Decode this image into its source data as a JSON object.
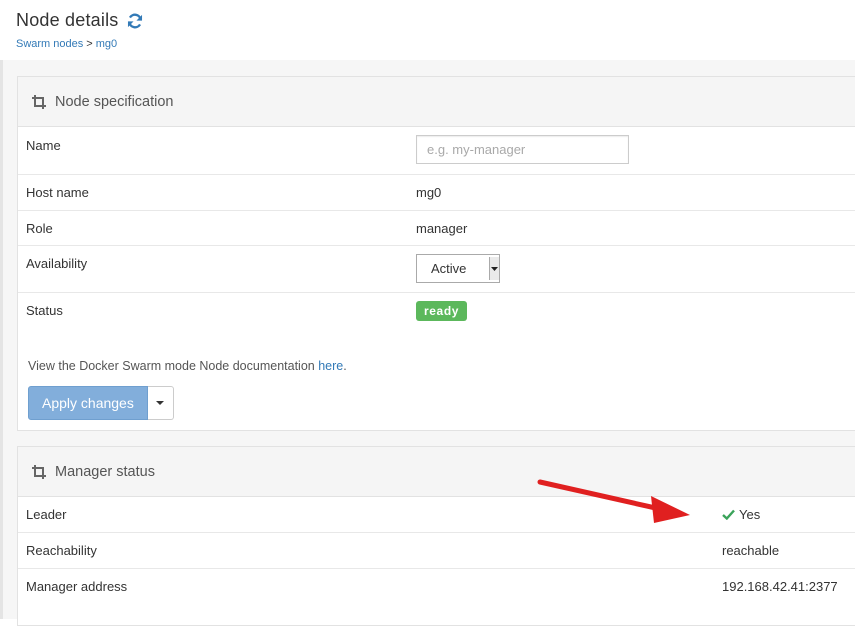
{
  "header": {
    "title": "Node details",
    "breadcrumb": {
      "parent": "Swarm nodes",
      "separator": ">",
      "current": "mg0"
    }
  },
  "node_spec": {
    "title": "Node specification",
    "name_label": "Name",
    "name_placeholder": "e.g. my-manager",
    "host_label": "Host name",
    "host_value": "mg0",
    "role_label": "Role",
    "role_value": "manager",
    "availability_label": "Availability",
    "availability_value": "Active",
    "status_label": "Status",
    "status_value": "ready",
    "doc_text": "View the Docker Swarm mode Node documentation ",
    "doc_link": "here",
    "doc_period": ".",
    "apply_button": "Apply changes"
  },
  "manager_status": {
    "title": "Manager status",
    "leader_label": "Leader",
    "leader_value": "Yes",
    "reachability_label": "Reachability",
    "reachability_value": "reachable",
    "address_label": "Manager address",
    "address_value": "192.168.42.41:2377"
  },
  "colors": {
    "accent": "#337ab7",
    "status_ready": "#5cb85c",
    "apply_button": "#82aedb",
    "check": "#3aa35a",
    "arrow": "#e02020"
  },
  "icons": {
    "refresh": "refresh-icon",
    "widget_header": "crop-icon",
    "leader_check": "check-icon",
    "caret": "caret-down-icon"
  }
}
